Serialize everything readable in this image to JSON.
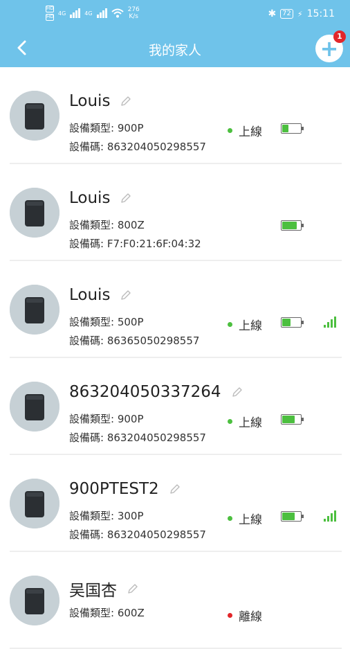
{
  "status_bar": {
    "sim1": "4G",
    "sim2": "4G",
    "net_speed": "276",
    "net_unit": "K/s",
    "battery": "72",
    "time": "15:11"
  },
  "header": {
    "title": "我的家人",
    "notification_count": "1"
  },
  "colors": {
    "header_bg": "#6fc3ea",
    "online_dot": "#4cbf3f",
    "offline_dot": "#e2262a",
    "battery_fill": "#4cbf3f"
  },
  "devices": [
    {
      "name": "Louis",
      "type_label": "設備類型: 900P",
      "code_label": "設備碼: 863204050298557",
      "status": "上線",
      "online": true,
      "battery_level": 0.35,
      "signal_bars": 0
    },
    {
      "name": "Louis",
      "type_label": "設備類型: 800Z",
      "code_label": "設備碼: F7:F0:21:6F:04:32",
      "status": "",
      "online": null,
      "battery_level": 0.8,
      "signal_bars": 0
    },
    {
      "name": "Louis",
      "type_label": "設備類型: 500P",
      "code_label": "設備碼: 86365050298557",
      "status": "上線",
      "online": true,
      "battery_level": 0.45,
      "signal_bars": 4
    },
    {
      "name": "863204050337264",
      "type_label": "設備類型: 900P",
      "code_label": "設備碼: 863204050298557",
      "status": "上線",
      "online": true,
      "battery_level": 0.7,
      "signal_bars": 0
    },
    {
      "name": "900PTEST2",
      "type_label": "設備類型: 300P",
      "code_label": "設備碼: 863204050298557",
      "status": "上線",
      "online": true,
      "battery_level": 0.7,
      "signal_bars": 4
    },
    {
      "name": "吴国杏",
      "type_label": "設備類型: 600Z",
      "code_label": "",
      "status": "離線",
      "online": false,
      "battery_level": 0,
      "signal_bars": 0
    }
  ]
}
